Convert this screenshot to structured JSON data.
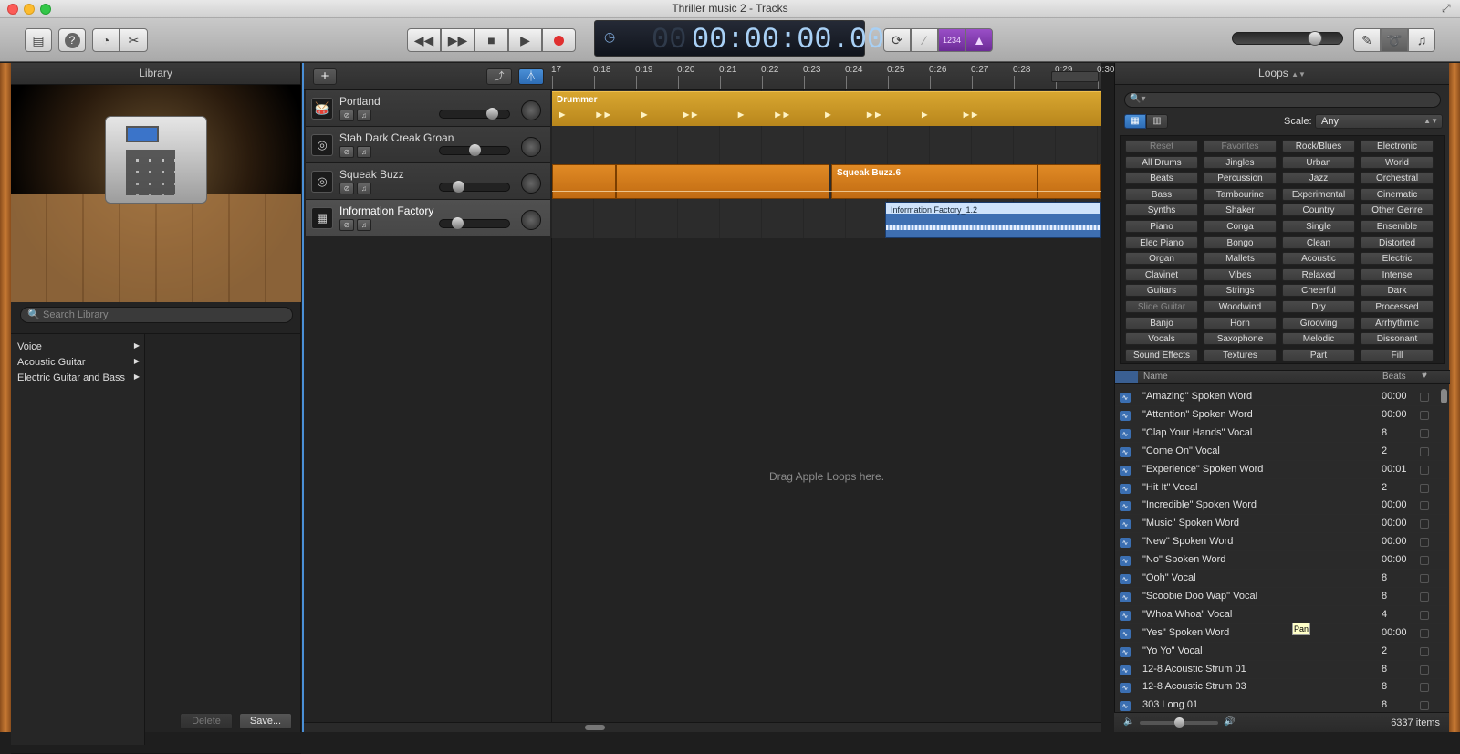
{
  "window": {
    "title": "Thriller music 2 - Tracks"
  },
  "lcd": {
    "time": "00:00:00.00",
    "beats": "1234"
  },
  "library": {
    "title": "Library",
    "search_placeholder": "Search Library",
    "categories": [
      "Voice",
      "Acoustic Guitar",
      "Electric Guitar and Bass"
    ],
    "delete_label": "Delete",
    "save_label": "Save..."
  },
  "tracks": [
    {
      "name": "Portland",
      "icon": "drums-icon"
    },
    {
      "name": "Stab Dark Creak Groan",
      "icon": "turntable-icon"
    },
    {
      "name": "Squeak Buzz",
      "icon": "turntable-icon"
    },
    {
      "name": "Information Factory",
      "icon": "keyboard-icon"
    }
  ],
  "regions": {
    "drummer": "Drummer",
    "squeak": "Squeak Buzz.6",
    "info": "Information Factory_1.2"
  },
  "ruler": [
    "17",
    "0:18",
    "0:19",
    "0:20",
    "0:21",
    "0:22",
    "0:23",
    "0:24",
    "0:25",
    "0:26",
    "0:27",
    "0:28",
    "0:29",
    "0:30"
  ],
  "empty_hint": "Drag Apple Loops here.",
  "loops": {
    "title": "Loops",
    "scale_label": "Scale:",
    "scale_value": "Any",
    "keywords": [
      [
        "Reset",
        "Favorites",
        "Rock/Blues",
        "Electronic"
      ],
      [
        "All Drums",
        "Jingles",
        "Urban",
        "World"
      ],
      [
        "Beats",
        "Percussion",
        "Jazz",
        "Orchestral"
      ],
      [
        "Bass",
        "Tambourine",
        "Experimental",
        "Cinematic"
      ],
      [
        "Synths",
        "Shaker",
        "Country",
        "Other Genre"
      ],
      [
        "Piano",
        "Conga",
        "Single",
        "Ensemble"
      ],
      [
        "Elec Piano",
        "Bongo",
        "Clean",
        "Distorted"
      ],
      [
        "Organ",
        "Mallets",
        "Acoustic",
        "Electric"
      ],
      [
        "Clavinet",
        "Vibes",
        "Relaxed",
        "Intense"
      ],
      [
        "Guitars",
        "Strings",
        "Cheerful",
        "Dark"
      ],
      [
        "Slide Guitar",
        "Woodwind",
        "Dry",
        "Processed"
      ],
      [
        "Banjo",
        "Horn",
        "Grooving",
        "Arrhythmic"
      ],
      [
        "Vocals",
        "Saxophone",
        "Melodic",
        "Dissonant"
      ],
      [
        "Sound Effects",
        "Textures",
        "Part",
        "Fill"
      ]
    ],
    "col_name": "Name",
    "col_beats": "Beats",
    "rows": [
      {
        "name": "\"Amazing\" Spoken Word",
        "beats": "00:00"
      },
      {
        "name": "\"Attention\" Spoken Word",
        "beats": "00:00"
      },
      {
        "name": "\"Clap Your Hands\" Vocal",
        "beats": "8"
      },
      {
        "name": "\"Come On\" Vocal",
        "beats": "2"
      },
      {
        "name": "\"Experience\" Spoken Word",
        "beats": "00:01"
      },
      {
        "name": "\"Hit It\" Vocal",
        "beats": "2"
      },
      {
        "name": "\"Incredible\" Spoken Word",
        "beats": "00:00"
      },
      {
        "name": "\"Music\" Spoken Word",
        "beats": "00:00"
      },
      {
        "name": "\"New\" Spoken Word",
        "beats": "00:00"
      },
      {
        "name": "\"No\" Spoken Word",
        "beats": "00:00"
      },
      {
        "name": "\"Ooh\" Vocal",
        "beats": "8"
      },
      {
        "name": "\"Scoobie Doo Wap\" Vocal",
        "beats": "8"
      },
      {
        "name": "\"Whoa Whoa\" Vocal",
        "beats": "4"
      },
      {
        "name": "\"Yes\" Spoken Word",
        "beats": "00:00"
      },
      {
        "name": "\"Yo Yo\" Vocal",
        "beats": "2"
      },
      {
        "name": "12-8 Acoustic Strum 01",
        "beats": "8"
      },
      {
        "name": "12-8 Acoustic Strum 03",
        "beats": "8"
      },
      {
        "name": "303 Long 01",
        "beats": "8"
      }
    ],
    "count": "6337 items",
    "tooltip": "Pan"
  }
}
